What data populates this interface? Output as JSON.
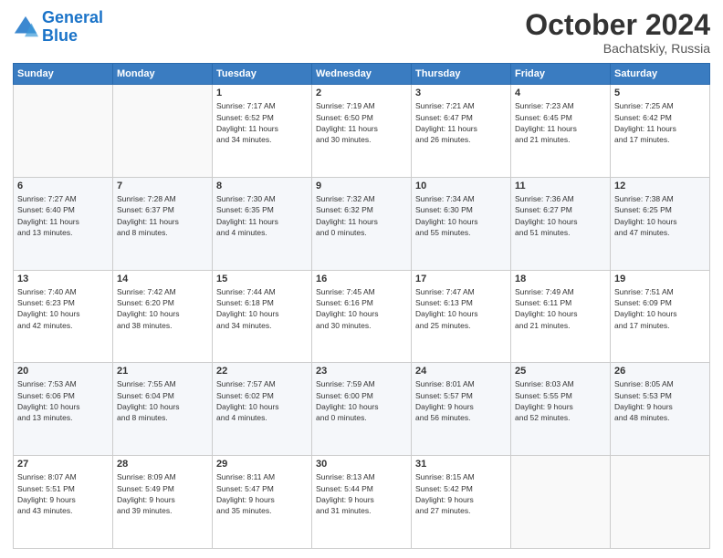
{
  "header": {
    "logo_line1": "General",
    "logo_line2": "Blue",
    "month": "October 2024",
    "location": "Bachatskiy, Russia"
  },
  "days_of_week": [
    "Sunday",
    "Monday",
    "Tuesday",
    "Wednesday",
    "Thursday",
    "Friday",
    "Saturday"
  ],
  "weeks": [
    [
      {
        "day": "",
        "info": ""
      },
      {
        "day": "",
        "info": ""
      },
      {
        "day": "1",
        "info": "Sunrise: 7:17 AM\nSunset: 6:52 PM\nDaylight: 11 hours\nand 34 minutes."
      },
      {
        "day": "2",
        "info": "Sunrise: 7:19 AM\nSunset: 6:50 PM\nDaylight: 11 hours\nand 30 minutes."
      },
      {
        "day": "3",
        "info": "Sunrise: 7:21 AM\nSunset: 6:47 PM\nDaylight: 11 hours\nand 26 minutes."
      },
      {
        "day": "4",
        "info": "Sunrise: 7:23 AM\nSunset: 6:45 PM\nDaylight: 11 hours\nand 21 minutes."
      },
      {
        "day": "5",
        "info": "Sunrise: 7:25 AM\nSunset: 6:42 PM\nDaylight: 11 hours\nand 17 minutes."
      }
    ],
    [
      {
        "day": "6",
        "info": "Sunrise: 7:27 AM\nSunset: 6:40 PM\nDaylight: 11 hours\nand 13 minutes."
      },
      {
        "day": "7",
        "info": "Sunrise: 7:28 AM\nSunset: 6:37 PM\nDaylight: 11 hours\nand 8 minutes."
      },
      {
        "day": "8",
        "info": "Sunrise: 7:30 AM\nSunset: 6:35 PM\nDaylight: 11 hours\nand 4 minutes."
      },
      {
        "day": "9",
        "info": "Sunrise: 7:32 AM\nSunset: 6:32 PM\nDaylight: 11 hours\nand 0 minutes."
      },
      {
        "day": "10",
        "info": "Sunrise: 7:34 AM\nSunset: 6:30 PM\nDaylight: 10 hours\nand 55 minutes."
      },
      {
        "day": "11",
        "info": "Sunrise: 7:36 AM\nSunset: 6:27 PM\nDaylight: 10 hours\nand 51 minutes."
      },
      {
        "day": "12",
        "info": "Sunrise: 7:38 AM\nSunset: 6:25 PM\nDaylight: 10 hours\nand 47 minutes."
      }
    ],
    [
      {
        "day": "13",
        "info": "Sunrise: 7:40 AM\nSunset: 6:23 PM\nDaylight: 10 hours\nand 42 minutes."
      },
      {
        "day": "14",
        "info": "Sunrise: 7:42 AM\nSunset: 6:20 PM\nDaylight: 10 hours\nand 38 minutes."
      },
      {
        "day": "15",
        "info": "Sunrise: 7:44 AM\nSunset: 6:18 PM\nDaylight: 10 hours\nand 34 minutes."
      },
      {
        "day": "16",
        "info": "Sunrise: 7:45 AM\nSunset: 6:16 PM\nDaylight: 10 hours\nand 30 minutes."
      },
      {
        "day": "17",
        "info": "Sunrise: 7:47 AM\nSunset: 6:13 PM\nDaylight: 10 hours\nand 25 minutes."
      },
      {
        "day": "18",
        "info": "Sunrise: 7:49 AM\nSunset: 6:11 PM\nDaylight: 10 hours\nand 21 minutes."
      },
      {
        "day": "19",
        "info": "Sunrise: 7:51 AM\nSunset: 6:09 PM\nDaylight: 10 hours\nand 17 minutes."
      }
    ],
    [
      {
        "day": "20",
        "info": "Sunrise: 7:53 AM\nSunset: 6:06 PM\nDaylight: 10 hours\nand 13 minutes."
      },
      {
        "day": "21",
        "info": "Sunrise: 7:55 AM\nSunset: 6:04 PM\nDaylight: 10 hours\nand 8 minutes."
      },
      {
        "day": "22",
        "info": "Sunrise: 7:57 AM\nSunset: 6:02 PM\nDaylight: 10 hours\nand 4 minutes."
      },
      {
        "day": "23",
        "info": "Sunrise: 7:59 AM\nSunset: 6:00 PM\nDaylight: 10 hours\nand 0 minutes."
      },
      {
        "day": "24",
        "info": "Sunrise: 8:01 AM\nSunset: 5:57 PM\nDaylight: 9 hours\nand 56 minutes."
      },
      {
        "day": "25",
        "info": "Sunrise: 8:03 AM\nSunset: 5:55 PM\nDaylight: 9 hours\nand 52 minutes."
      },
      {
        "day": "26",
        "info": "Sunrise: 8:05 AM\nSunset: 5:53 PM\nDaylight: 9 hours\nand 48 minutes."
      }
    ],
    [
      {
        "day": "27",
        "info": "Sunrise: 8:07 AM\nSunset: 5:51 PM\nDaylight: 9 hours\nand 43 minutes."
      },
      {
        "day": "28",
        "info": "Sunrise: 8:09 AM\nSunset: 5:49 PM\nDaylight: 9 hours\nand 39 minutes."
      },
      {
        "day": "29",
        "info": "Sunrise: 8:11 AM\nSunset: 5:47 PM\nDaylight: 9 hours\nand 35 minutes."
      },
      {
        "day": "30",
        "info": "Sunrise: 8:13 AM\nSunset: 5:44 PM\nDaylight: 9 hours\nand 31 minutes."
      },
      {
        "day": "31",
        "info": "Sunrise: 8:15 AM\nSunset: 5:42 PM\nDaylight: 9 hours\nand 27 minutes."
      },
      {
        "day": "",
        "info": ""
      },
      {
        "day": "",
        "info": ""
      }
    ]
  ]
}
